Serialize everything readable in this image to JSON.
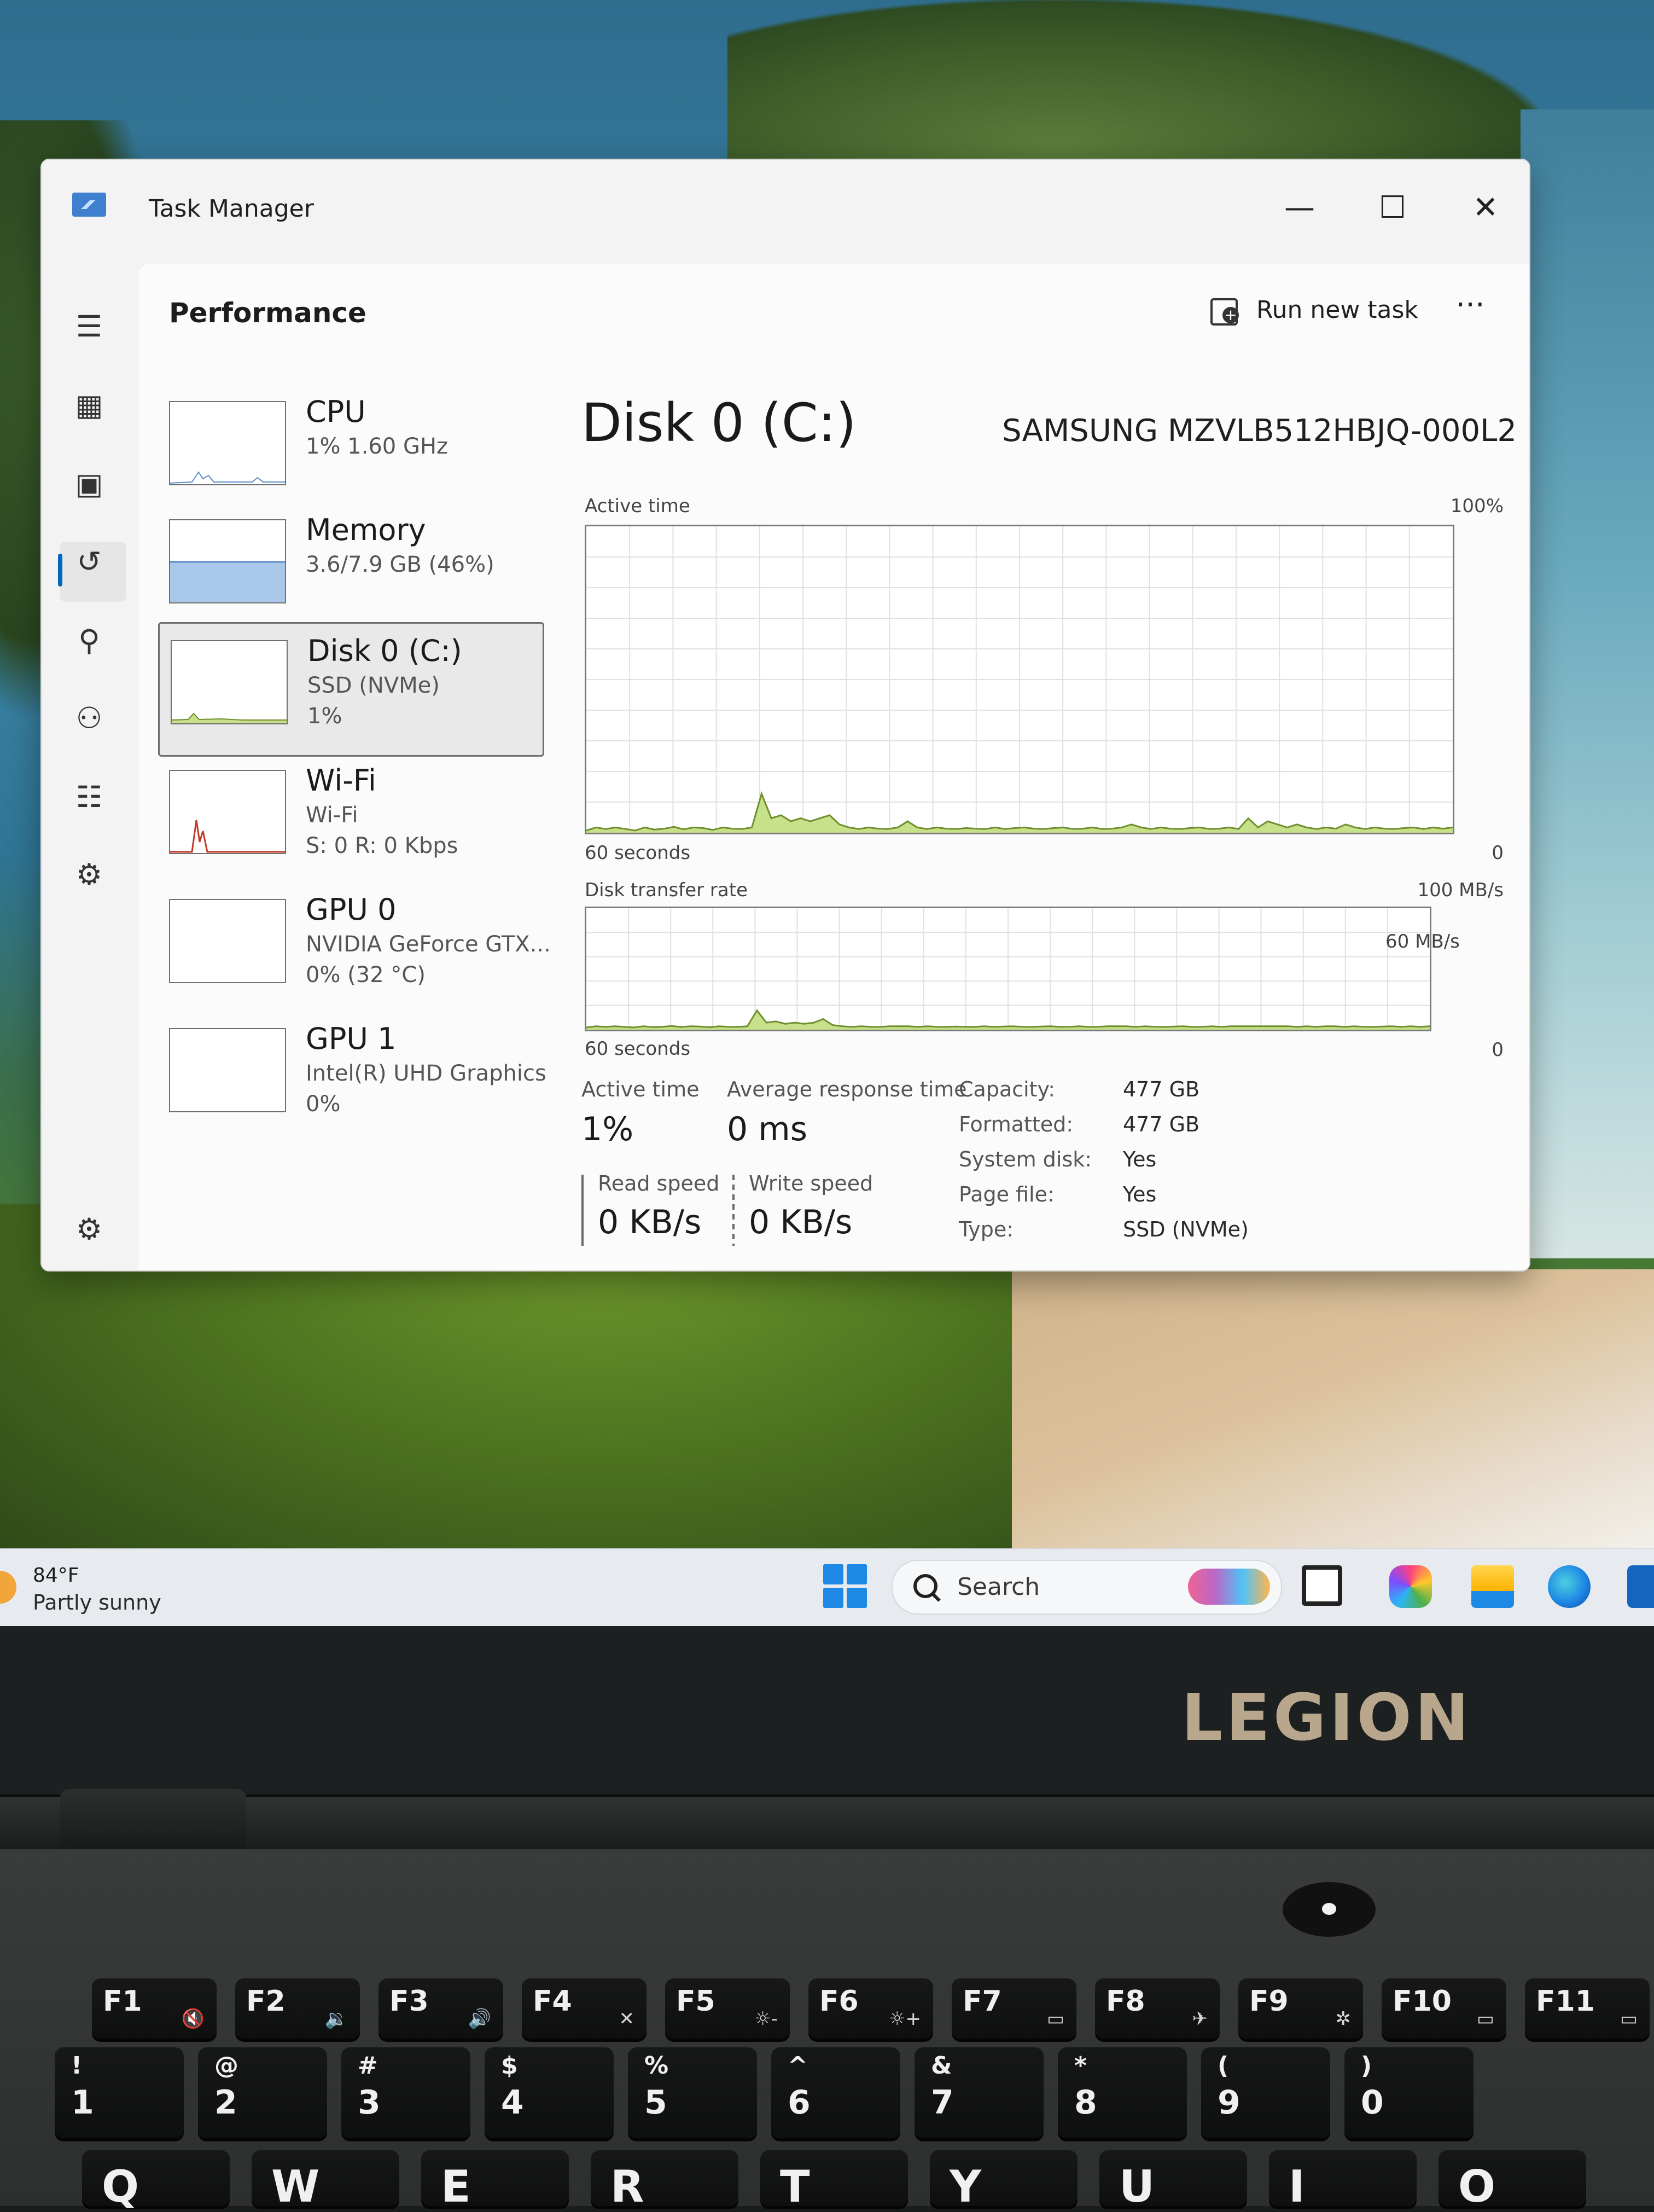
{
  "window": {
    "title": "Task Manager",
    "minimize_glyph": "—",
    "maximize_glyph": "☐",
    "close_glyph": "✕"
  },
  "header": {
    "title": "Performance",
    "run_new_task": "Run new task",
    "more_glyph": "···"
  },
  "nav": [
    {
      "name": "menu-icon",
      "glyph": "☰"
    },
    {
      "name": "processes-icon",
      "glyph": "▦"
    },
    {
      "name": "performance-icon",
      "glyph": "▣"
    },
    {
      "name": "app-history-icon",
      "glyph": "↺"
    },
    {
      "name": "startup-apps-icon",
      "glyph": "⚲"
    },
    {
      "name": "users-icon",
      "glyph": "⚇"
    },
    {
      "name": "details-icon",
      "glyph": "☷"
    },
    {
      "name": "services-icon",
      "glyph": "⚙"
    },
    {
      "name": "settings-icon",
      "glyph": "⚙"
    }
  ],
  "devices": [
    {
      "name": "CPU",
      "line1": "1% 1.60 GHz",
      "line2": ""
    },
    {
      "name": "Memory",
      "line1": "3.6/7.9 GB (46%)",
      "line2": ""
    },
    {
      "name": "Disk 0 (C:)",
      "line1": "SSD (NVMe)",
      "line2": "1%"
    },
    {
      "name": "Wi-Fi",
      "line1": "Wi-Fi",
      "line2": "S: 0 R: 0 Kbps"
    },
    {
      "name": "GPU 0",
      "line1": "NVIDIA GeForce GTX...",
      "line2": "0% (32 °C)"
    },
    {
      "name": "GPU 1",
      "line1": "Intel(R) UHD Graphics",
      "line2": "0%"
    }
  ],
  "detail": {
    "title": "Disk 0 (C:)",
    "model": "SAMSUNG MZVLB512HBJQ-000L2",
    "active_time_graph": {
      "label": "Active time",
      "max_label": "100%",
      "x_left": "60 seconds",
      "x_right": "0",
      "values": [
        0,
        1,
        0.5,
        1,
        0.5,
        0,
        1,
        0.3,
        0.6,
        1.2,
        0.4,
        1,
        0.8,
        0.2,
        1,
        0.6,
        0.5,
        1,
        12,
        4,
        5,
        3,
        4,
        3,
        4,
        5,
        2,
        1,
        0.5,
        1,
        0.6,
        0.5,
        1,
        3,
        1,
        0.5,
        1,
        0.6,
        0.5,
        0.8,
        0.6,
        0.5,
        1,
        0.5,
        0.8,
        1,
        0.6,
        0.5,
        0.8,
        1,
        0.5,
        0.6,
        1,
        0.5,
        0.6,
        1,
        2,
        1,
        0.5,
        1,
        0.6,
        0.5,
        0.8,
        1,
        0.5,
        0.6,
        1,
        0.5,
        4,
        1,
        3,
        2,
        1,
        2,
        1,
        0.5,
        1,
        0.6,
        2,
        1,
        0.5,
        1,
        0.6,
        0.5,
        0.8,
        1,
        0.5,
        1,
        0.6,
        1
      ]
    },
    "transfer_graph": {
      "label": "Disk transfer rate",
      "max_label": "100 MB/s",
      "secondary_label": "60 MB/s",
      "x_left": "60 seconds",
      "x_right": "0",
      "values": [
        0,
        1,
        0.5,
        1,
        0.5,
        0,
        1,
        0.3,
        0.6,
        1.2,
        0.4,
        1,
        0.8,
        0.2,
        1,
        0.6,
        0.5,
        1,
        14,
        4,
        5,
        3,
        4,
        3,
        4,
        7,
        2,
        1,
        0.5,
        1,
        0.6,
        0.5,
        1,
        1,
        1,
        0.5,
        1,
        0.6,
        0.5,
        0.8,
        0.6,
        0.5,
        1,
        0.5,
        0.8,
        1,
        0.6,
        0.5,
        0.8,
        1,
        0.5,
        0.6,
        1,
        0.5,
        0.6,
        1,
        1,
        1,
        0.5,
        1,
        0.6,
        0.5,
        0.8,
        1,
        0.5,
        0.6,
        1,
        0.5,
        1,
        1,
        1,
        1,
        1,
        1,
        1,
        0.5,
        1,
        0.6,
        1,
        1,
        0.5,
        1,
        0.6,
        0.5,
        0.8,
        1,
        0.5,
        1,
        0.6,
        1
      ]
    },
    "stats": {
      "active_time_label": "Active time",
      "active_time_value": "1%",
      "avg_response_label": "Average response time",
      "avg_response_value": "0 ms",
      "read_label": "Read speed",
      "read_value": "0 KB/s",
      "write_label": "Write speed",
      "write_value": "0 KB/s"
    },
    "properties": [
      {
        "key": "Capacity:",
        "value": "477 GB"
      },
      {
        "key": "Formatted:",
        "value": "477 GB"
      },
      {
        "key": "System disk:",
        "value": "Yes"
      },
      {
        "key": "Page file:",
        "value": "Yes"
      },
      {
        "key": "Type:",
        "value": "SSD (NVMe)"
      }
    ]
  },
  "taskbar": {
    "temperature": "84°F",
    "condition": "Partly sunny",
    "search_placeholder": "Search"
  },
  "laptop": {
    "brand": "LEGION"
  },
  "keyboard": {
    "fn_keys": [
      {
        "main": "F1",
        "sub": "🔇"
      },
      {
        "main": "F2",
        "sub": "🔉"
      },
      {
        "main": "F3",
        "sub": "🔊"
      },
      {
        "main": "F4",
        "sub": "✕"
      },
      {
        "main": "F5",
        "sub": "☼-"
      },
      {
        "main": "F6",
        "sub": "☼+"
      },
      {
        "main": "F7",
        "sub": "▭"
      },
      {
        "main": "F8",
        "sub": "✈"
      },
      {
        "main": "F9",
        "sub": "✲"
      },
      {
        "main": "F10",
        "sub": "▭"
      },
      {
        "main": "F11",
        "sub": "▭"
      }
    ],
    "number_keys": [
      {
        "top": "!",
        "bottom": "1"
      },
      {
        "top": "@",
        "bottom": "2"
      },
      {
        "top": "#",
        "bottom": "3"
      },
      {
        "top": "$",
        "bottom": "4"
      },
      {
        "top": "%",
        "bottom": "5"
      },
      {
        "top": "^",
        "bottom": "6"
      },
      {
        "top": "&",
        "bottom": "7"
      },
      {
        "top": "*",
        "bottom": "8"
      },
      {
        "top": "(",
        "bottom": "9"
      },
      {
        "top": ")",
        "bottom": "0"
      }
    ],
    "letter_keys": [
      "Q",
      "W",
      "E",
      "R",
      "T",
      "Y",
      "U",
      "I",
      "O"
    ]
  },
  "colors": {
    "accent": "#0067c0",
    "graph_fill": "#c7e08a",
    "graph_line": "#6f8f2e",
    "memory_fill": "#a9c7e8",
    "memory_line": "#5b8cc8",
    "wifi_line": "#c0392b",
    "grid": "#e1e1e1"
  }
}
